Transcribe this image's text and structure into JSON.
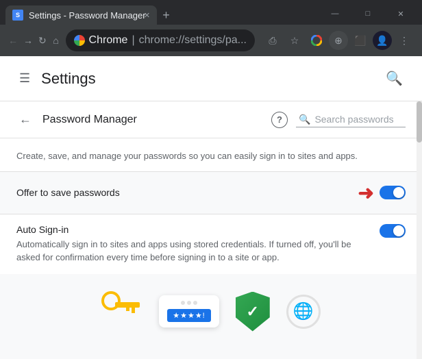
{
  "browser": {
    "tab_title": "Settings - Password Manager",
    "tab_favicon_letter": "S",
    "new_tab_label": "+",
    "window_controls": {
      "minimize": "—",
      "maximize": "□",
      "close": "✕"
    },
    "address_bar": {
      "chrome_label": "Chrome",
      "address": "chrome://settings/pa...",
      "divider": "|"
    }
  },
  "settings": {
    "title": "Settings",
    "hamburger_aria": "Menu",
    "search_aria": "Search settings"
  },
  "password_manager": {
    "title": "Password Manager",
    "back_aria": "Back",
    "help_aria": "Help",
    "search_placeholder": "Search passwords",
    "description": "Create, save, and manage your passwords so you can easily sign in to sites and apps.",
    "offer_to_save": {
      "label": "Offer to save passwords",
      "enabled": true
    },
    "auto_signin": {
      "title": "Auto Sign-in",
      "description": "Automatically sign in to sites and apps using stored credentials. If turned off, you'll be asked for confirmation every time before signing in to a site or app.",
      "enabled": true
    }
  },
  "illustration": {
    "password_dots": "••••!",
    "password_label": "★★★★!"
  }
}
